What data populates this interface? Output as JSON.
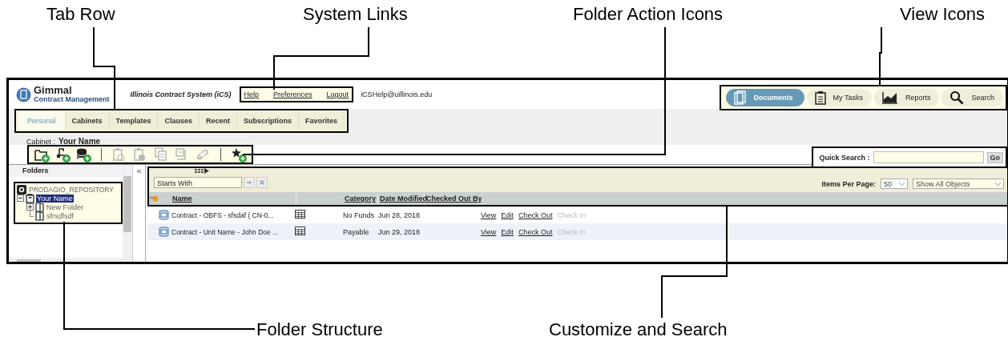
{
  "callouts_top": [
    "Tab Row",
    "System Links",
    "Folder Action Icons",
    "View Icons"
  ],
  "callouts_bottom": [
    "Folder Structure",
    "Customize and Search"
  ],
  "header": {
    "logo_title": "Gimmal",
    "logo_subtitle": "Contract Management",
    "system_name": "Illinois Contract System (iCS)",
    "system_links": [
      "Help",
      "Preferences",
      "Logout"
    ],
    "email": "iCSHelp@uillinois.edu"
  },
  "view_buttons": [
    {
      "label": "Documents",
      "kind": "documents",
      "selected": true
    },
    {
      "label": "My Tasks",
      "kind": "tasks",
      "selected": false
    },
    {
      "label": "Reports",
      "kind": "reports",
      "selected": false
    },
    {
      "label": "Search",
      "kind": "search",
      "selected": false
    }
  ],
  "tabs": [
    {
      "label": "Personal",
      "selected": true
    },
    {
      "label": "Cabinets",
      "selected": false
    },
    {
      "label": "Templates",
      "selected": false
    },
    {
      "label": "Clauses",
      "selected": false
    },
    {
      "label": "Recent",
      "selected": false
    },
    {
      "label": "Subscriptions",
      "selected": false
    },
    {
      "label": "Favorites",
      "selected": false
    }
  ],
  "cabinet": {
    "label": "Cabinet :",
    "value": "Your Name"
  },
  "folder_actions": [
    [
      {
        "kind": "new-folder",
        "disabled": false
      },
      {
        "kind": "new-subfolder",
        "disabled": false
      },
      {
        "kind": "upload",
        "disabled": false
      }
    ],
    [
      {
        "kind": "clipboard-add",
        "disabled": true
      },
      {
        "kind": "clipboard-info",
        "disabled": true
      },
      {
        "kind": "copy",
        "disabled": true
      },
      {
        "kind": "export",
        "disabled": true
      },
      {
        "kind": "link",
        "disabled": true
      }
    ],
    [
      {
        "kind": "favorite-add",
        "disabled": false
      }
    ]
  ],
  "quick_search": {
    "label": "Quick Search :",
    "button": "Go"
  },
  "folders_panel": {
    "title": "Folders",
    "collapse": "«",
    "tree": {
      "label": "PRODAGIO_REPOSITORY",
      "children": [
        {
          "label": "Your Name",
          "selected": true,
          "expanded": true,
          "children": [
            {
              "label": "New Folder",
              "selected": false,
              "expanded": false
            },
            {
              "label": "sfrsdfsdf",
              "selected": false
            }
          ]
        }
      ]
    }
  },
  "filter": {
    "value": "Starts With"
  },
  "items_per_page": {
    "label": "Items Per Page:",
    "value": "50"
  },
  "object_filter": {
    "value": "Show All Objects"
  },
  "columns": [
    "Name",
    "Category",
    "Date Modified",
    "Checked Out By"
  ],
  "rows": [
    {
      "name": "Contract - OBFS - sfsdaf ( CN-0...",
      "category": "No Funds",
      "date": "Jun 28, 2018",
      "actions": [
        {
          "label": "View",
          "disabled": false
        },
        {
          "label": "Edit",
          "disabled": false
        },
        {
          "label": "Check Out",
          "disabled": false
        },
        {
          "label": "Check In",
          "disabled": true
        }
      ]
    },
    {
      "name": "Contract - Unit Name - John Doe ...",
      "category": "Payable",
      "date": "Jun 29, 2018",
      "actions": [
        {
          "label": "View",
          "disabled": false
        },
        {
          "label": "Edit",
          "disabled": false
        },
        {
          "label": "Check Out",
          "disabled": false
        },
        {
          "label": "Check In",
          "disabled": true
        }
      ]
    }
  ]
}
